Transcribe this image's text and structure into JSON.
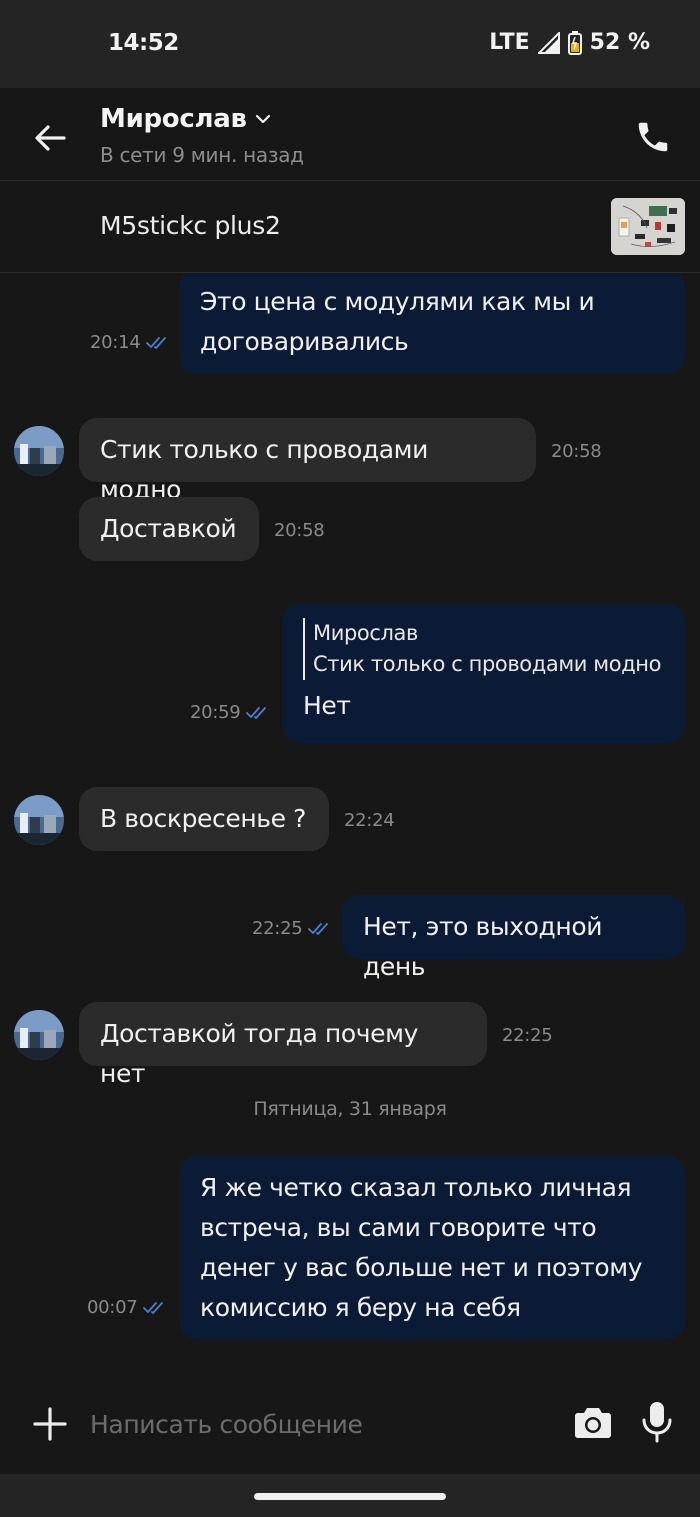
{
  "status_bar": {
    "time": "14:52",
    "network": "LTE",
    "battery": "52 %"
  },
  "header": {
    "contact_name": "Мирослав",
    "contact_status": "В сети 9 мин. назад"
  },
  "product": {
    "title": "M5stickc plus2"
  },
  "messages": [
    {
      "direction": "out",
      "lines": [
        "Это цена с модулями как мы и",
        "договаривались"
      ],
      "time": "20:14"
    },
    {
      "direction": "in",
      "lines": [
        "Стик только с проводами модно"
      ],
      "time": "20:58"
    },
    {
      "direction": "in",
      "lines": [
        "Доставкой"
      ],
      "time": "20:58"
    },
    {
      "direction": "out",
      "quote": {
        "author": "Мирослав",
        "text": "Стик только с проводами модно"
      },
      "lines": [
        "Нет"
      ],
      "time": "20:59"
    },
    {
      "direction": "in",
      "lines": [
        "В воскресенье ?"
      ],
      "time": "22:24"
    },
    {
      "direction": "out",
      "lines": [
        "Нет, это выходной день"
      ],
      "time": "22:25"
    },
    {
      "direction": "in",
      "lines": [
        "Доставкой тогда почему нет"
      ],
      "time": "22:25"
    },
    {
      "direction": "out",
      "lines": [
        "Я же четко сказал только личная",
        "встреча, вы сами говорите что",
        "денег у вас больше нет и поэтому",
        "комиссию я беру на себя"
      ],
      "time": "00:07"
    }
  ],
  "date_separator": "Пятница, 31 января",
  "input": {
    "placeholder": "Написать сообщение"
  },
  "icons": {
    "back": "arrow-left-icon",
    "dropdown": "chevron-down-icon",
    "call": "phone-icon",
    "read_receipt": "double-check-icon",
    "add": "plus-icon",
    "camera": "camera-icon",
    "mic": "microphone-icon"
  },
  "colors": {
    "background": "#171717",
    "outgoing_bubble": "#0c1b35",
    "incoming_bubble": "#2b2b2b",
    "read_check": "#4a7fd1"
  }
}
